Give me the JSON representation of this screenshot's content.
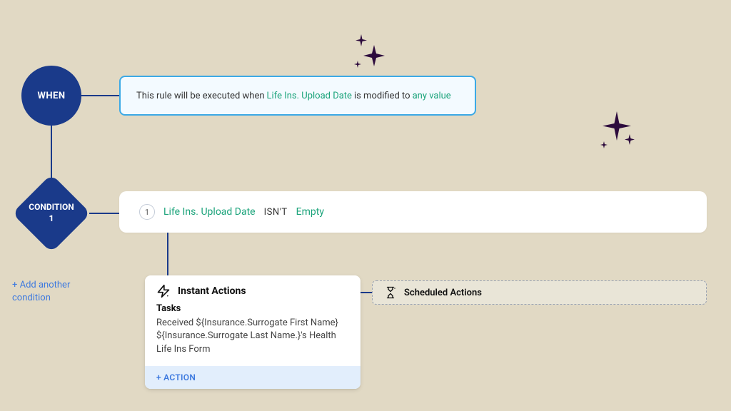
{
  "when": {
    "label": "WHEN",
    "text_pre": "This rule will be executed when ",
    "field": "Life Ins. Upload Date",
    "text_mid": " is modified to ",
    "value": "any value"
  },
  "condition": {
    "label_top": "CONDITION",
    "label_num": "1",
    "number": "1",
    "field": "Life Ins. Upload Date",
    "operator": "ISN'T",
    "value": "Empty"
  },
  "add_condition": "+ Add another condition",
  "instant": {
    "title": "Instant Actions",
    "tasks_label": "Tasks",
    "task_text": "Received ${Insurance.Surrogate First Name} ${Insurance.Surrogate Last Name.}'s Health Life Ins Form",
    "action_link": "+ ACTION"
  },
  "scheduled": {
    "title": "Scheduled Actions"
  }
}
